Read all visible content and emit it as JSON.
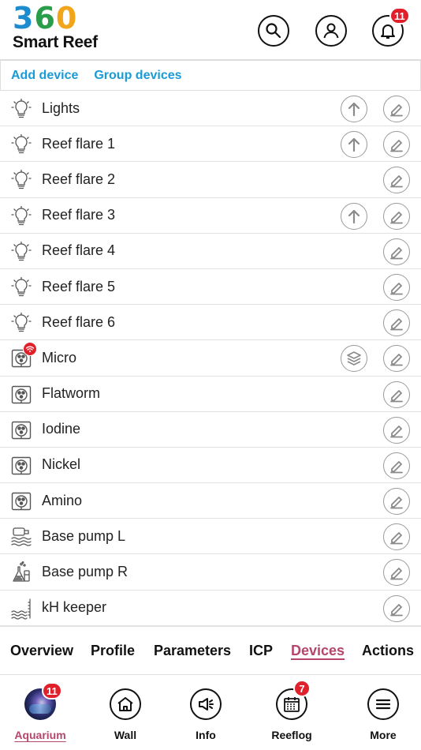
{
  "header": {
    "logo_number": [
      "3",
      "6",
      "0"
    ],
    "logo_text": "Smart Reef",
    "notification_count": "11",
    "icons": [
      "search-icon",
      "user-icon",
      "bell-icon"
    ]
  },
  "actions": {
    "add_device": "Add device",
    "group_devices": "Group devices"
  },
  "devices": [
    {
      "label": "Lights",
      "icon": "bulb-icon",
      "secondary": "upload-icon"
    },
    {
      "label": "Reef flare 1",
      "icon": "bulb-icon",
      "secondary": "upload-icon"
    },
    {
      "label": "Reef flare 2",
      "icon": "bulb-icon",
      "secondary": null
    },
    {
      "label": "Reef flare 3",
      "icon": "bulb-icon",
      "secondary": "upload-icon"
    },
    {
      "label": "Reef flare 4",
      "icon": "bulb-icon",
      "secondary": null
    },
    {
      "label": "Reef flare 5",
      "icon": "bulb-icon",
      "secondary": null
    },
    {
      "label": "Reef flare 6",
      "icon": "bulb-icon",
      "secondary": null
    },
    {
      "label": "Micro",
      "icon": "doser-icon",
      "secondary": "layers-icon",
      "wifi_badge": true
    },
    {
      "label": "Flatworm",
      "icon": "doser-icon",
      "secondary": null
    },
    {
      "label": "Iodine",
      "icon": "doser-icon",
      "secondary": null
    },
    {
      "label": "Nickel",
      "icon": "doser-icon",
      "secondary": null
    },
    {
      "label": "Amino",
      "icon": "doser-icon",
      "secondary": null
    },
    {
      "label": "Base pump L",
      "icon": "pump-icon",
      "secondary": null
    },
    {
      "label": "Base pump R",
      "icon": "flask-icon",
      "secondary": null
    },
    {
      "label": "kH keeper",
      "icon": "waves-icon",
      "secondary": null
    }
  ],
  "tabs": {
    "overview": "Overview",
    "profile": "Profile",
    "parameters": "Parameters",
    "icp": "ICP",
    "devices": "Devices",
    "actions": "Actions",
    "active": "Devices"
  },
  "bottom_nav": {
    "aquarium": "Aquarium",
    "aquarium_badge": "11",
    "wall": "Wall",
    "info": "Info",
    "reeflog": "Reeflog",
    "reeflog_badge": "7",
    "more": "More",
    "active": "Aquarium"
  },
  "colors": {
    "accent_link": "#1a9ad6",
    "active_tab": "#b5466b",
    "badge": "#e0202b",
    "logo_3": "#1d8ccf",
    "logo_6": "#2a9d4a",
    "logo_0": "#f1a51b"
  }
}
